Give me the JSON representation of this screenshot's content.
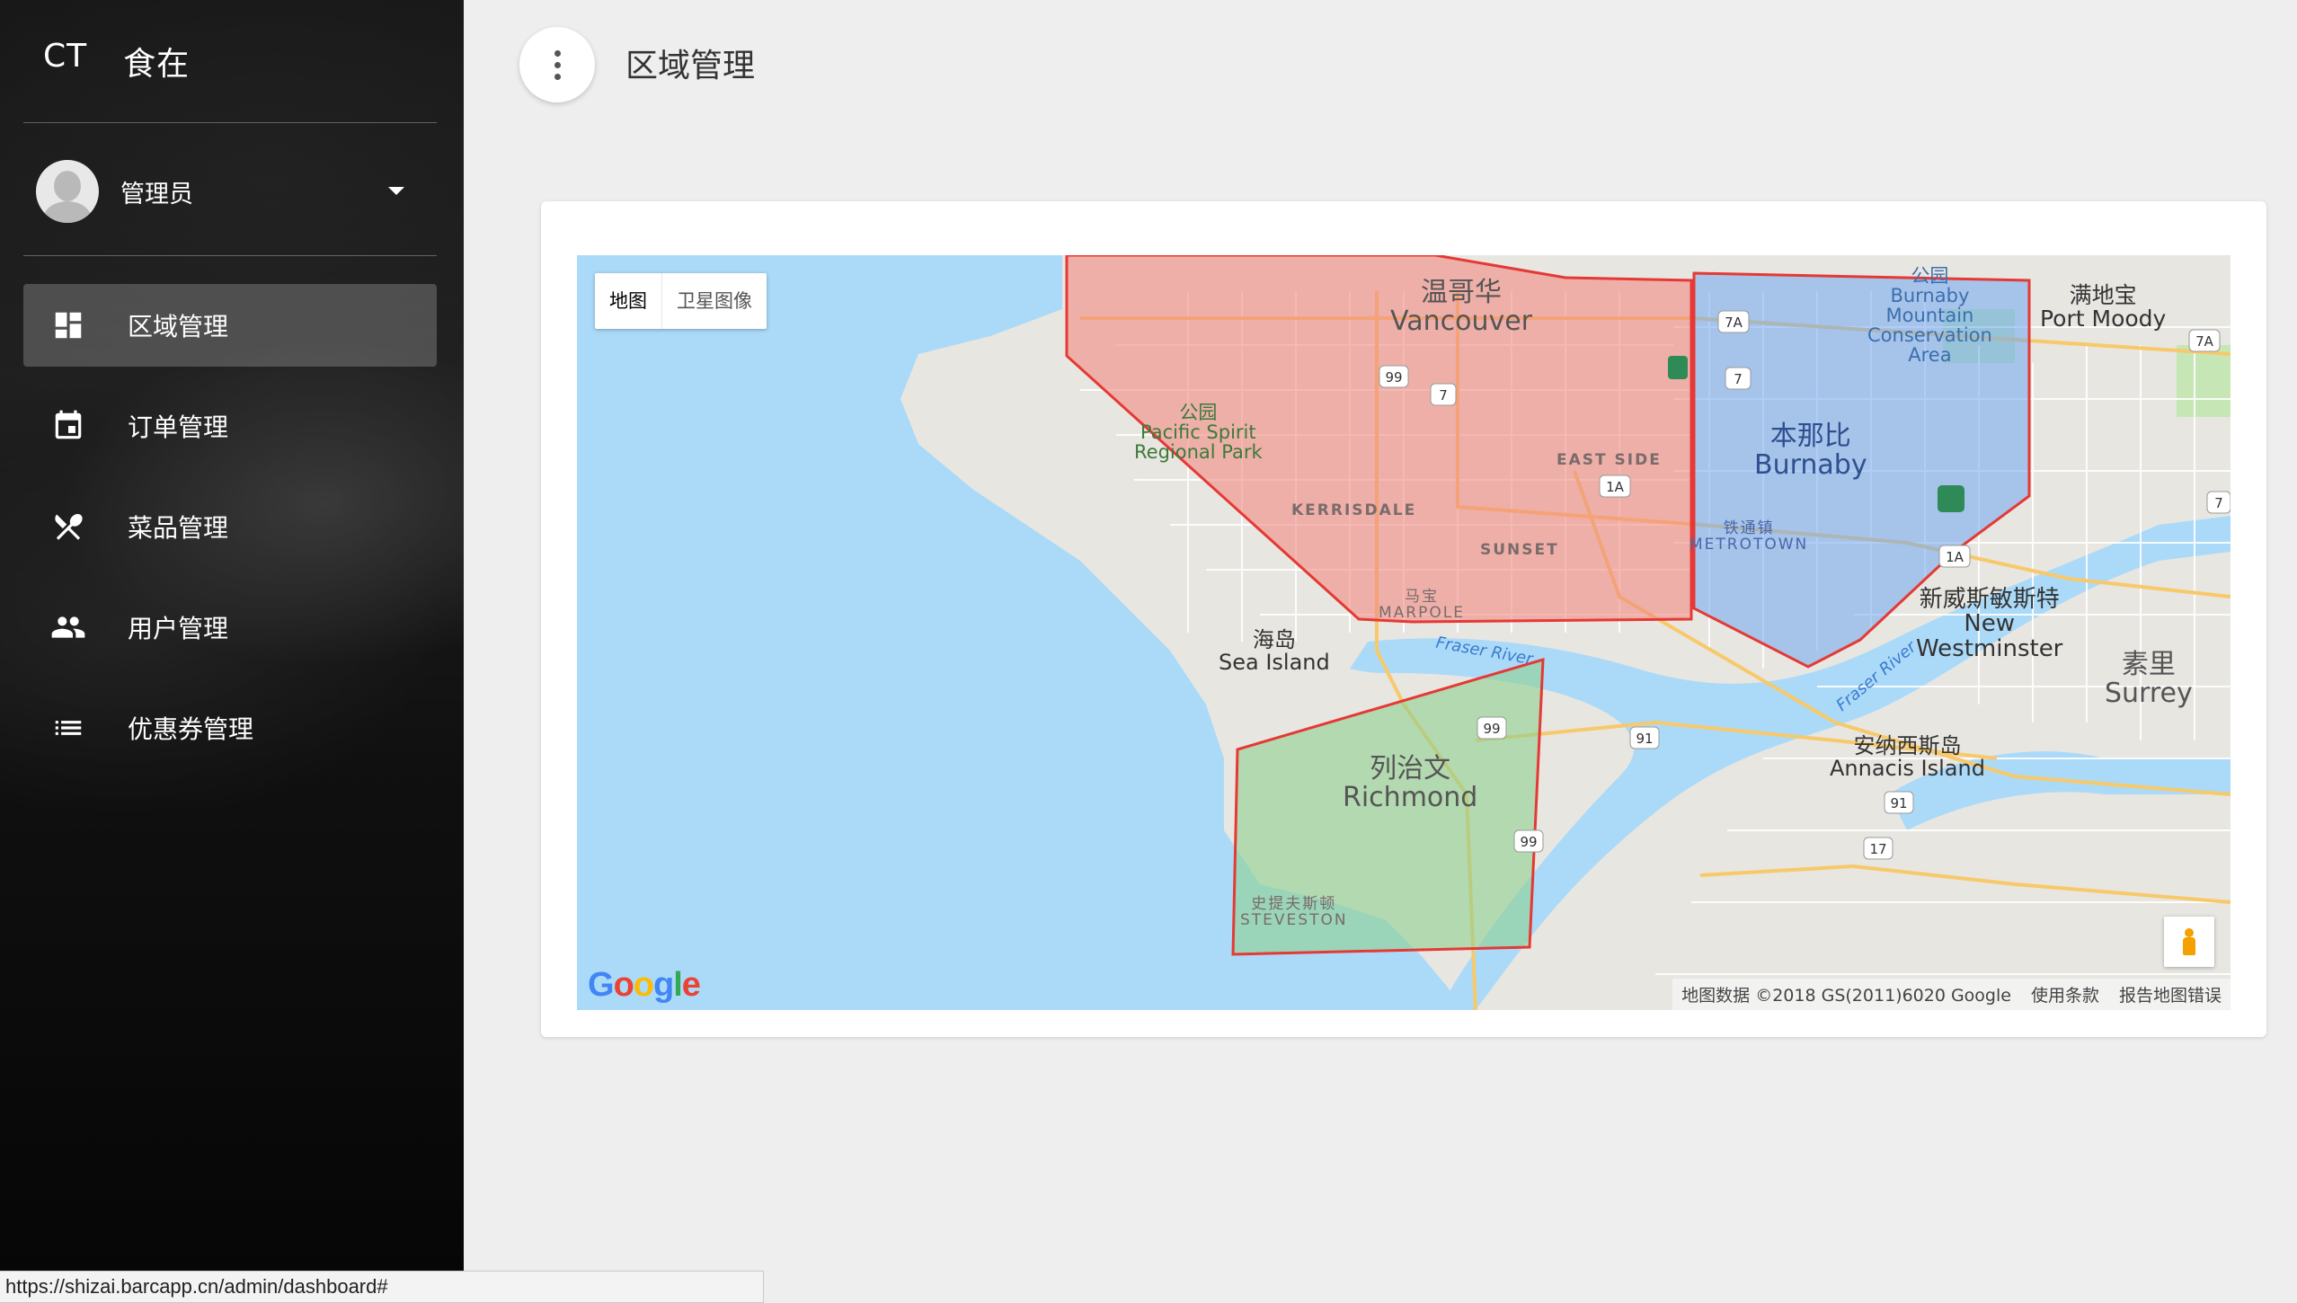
{
  "sidebar": {
    "brand_logo": "CT",
    "brand_name": "食在",
    "user": {
      "name": "管理员"
    },
    "items": [
      {
        "label": "区域管理",
        "icon": "dashboard-icon",
        "active": true
      },
      {
        "label": "订单管理",
        "icon": "calendar-icon",
        "active": false
      },
      {
        "label": "菜品管理",
        "icon": "utensils-icon",
        "active": false
      },
      {
        "label": "用户管理",
        "icon": "people-icon",
        "active": false
      },
      {
        "label": "优惠券管理",
        "icon": "list-icon",
        "active": false
      }
    ]
  },
  "header": {
    "title": "区域管理"
  },
  "map": {
    "type_buttons": [
      "地图",
      "卫星图像"
    ],
    "labels": {
      "vancouver_cn": "温哥华",
      "vancouver_en": "Vancouver",
      "park_cn": "公园",
      "park_en": "Pacific Spirit\nRegional Park",
      "kerrisdale": "KERRISDALE",
      "sunset": "SUNSET",
      "east_side": "EAST SIDE",
      "marpole_cn": "马宝",
      "marpole": "MARPOLE",
      "sea_island_cn": "海岛",
      "sea_island_en": "Sea Island",
      "richmond_cn": "列治文",
      "richmond_en": "Richmond",
      "steveston_cn": "史提夫斯顿",
      "steveston": "STEVESTON",
      "burnaby_park_cn": "公园",
      "burnaby_park_en": "Burnaby\nMountain\nConservation\nArea",
      "burnaby_cn": "本那比",
      "burnaby_en": "Burnaby",
      "metrotown_cn": "铁通镇",
      "metrotown": "METROTOWN",
      "port_moody_cn": "满地宝",
      "port_moody_en": "Port Moody",
      "new_west_cn": "新威斯敏斯特",
      "new_west_en": "New\nWestminster",
      "surrey_cn": "素里",
      "surrey_en": "Surrey",
      "annacis_cn": "安纳西斯岛",
      "annacis_en": "Annacis Island",
      "fraser_river_1": "Fraser River",
      "fraser_river_2": "Fraser River"
    },
    "route_shields": [
      "99",
      "7",
      "1A",
      "7A",
      "7",
      "7A",
      "1A",
      "7",
      "99",
      "99",
      "91",
      "91",
      "17"
    ],
    "google_logo": "Google",
    "attribution": [
      "地图数据 ©2018 GS(2011)6020 Google",
      "使用条款",
      "报告地图错误"
    ],
    "zones": [
      {
        "name": "Vancouver zone",
        "fill": "#f28b82",
        "stroke": "#e53935"
      },
      {
        "name": "Burnaby zone",
        "fill": "#6fa5f2",
        "stroke": "#e53935"
      },
      {
        "name": "Richmond zone",
        "fill": "#8fd18f",
        "stroke": "#e53935"
      }
    ]
  },
  "status_bar": {
    "url": "https://shizai.barcapp.cn/admin/dashboard#"
  }
}
